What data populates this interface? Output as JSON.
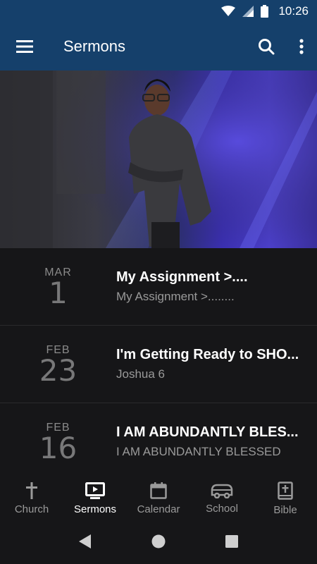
{
  "status_bar": {
    "time": "10:26"
  },
  "app_bar": {
    "title": "Sermons"
  },
  "sermons": [
    {
      "month": "MAR",
      "day": "1",
      "title": "My Assignment >....",
      "subtitle": "My Assignment    >........"
    },
    {
      "month": "FEB",
      "day": "23",
      "title": "I'm Getting Ready to SHO...",
      "subtitle": "Joshua 6"
    },
    {
      "month": "FEB",
      "day": "16",
      "title": "I AM ABUNDANTLY BLES...",
      "subtitle": "I AM ABUNDANTLY BLESSED"
    }
  ],
  "bottom_nav": [
    {
      "label": "Church",
      "icon": "cross-icon"
    },
    {
      "label": "Sermons",
      "icon": "tv-play-icon",
      "active": true
    },
    {
      "label": "Calendar",
      "icon": "calendar-icon"
    },
    {
      "label": "School",
      "icon": "bus-icon"
    },
    {
      "label": "Bible",
      "icon": "bible-icon"
    }
  ],
  "colors": {
    "app_bar": "#15406b",
    "background": "#161618",
    "muted_text": "#9a9a9a"
  }
}
